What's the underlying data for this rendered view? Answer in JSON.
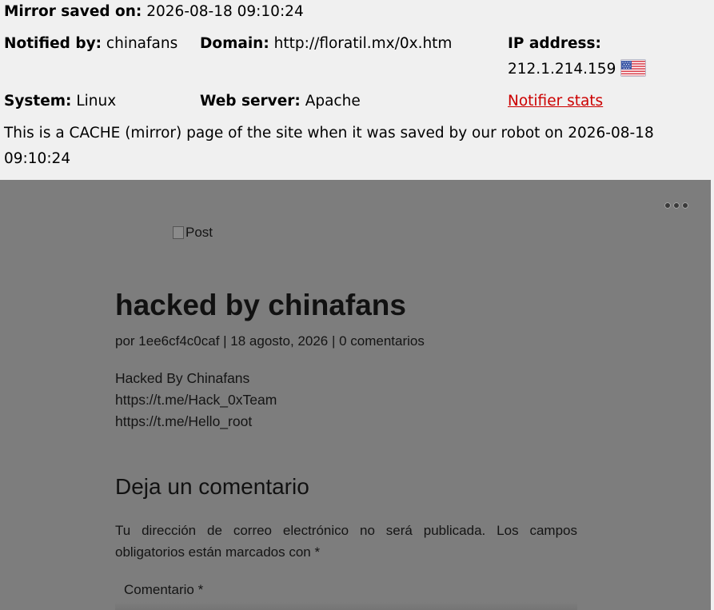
{
  "header": {
    "mirror_saved_label": "Mirror saved on:",
    "mirror_saved_value": "2026-08-18 09:10:24",
    "notified_by_label": "Notified by:",
    "notified_by_value": "chinafans",
    "domain_label": "Domain:",
    "domain_value": "http://floratil.mx/0x.htm",
    "ip_label": "IP address:",
    "ip_value": "212.1.214.159",
    "flag_icon": "us-flag-icon",
    "system_label": "System:",
    "system_value": "Linux",
    "web_server_label": "Web server:",
    "web_server_value": "Apache",
    "notifier_stats_link": "Notifier stats",
    "cache_notice": "This is a CACHE (mirror) page of the site when it was saved by our robot on 2026-08-18 09:10:24"
  },
  "mirror": {
    "menu_icon": "more-dots-icon",
    "post_image_alt": "Post",
    "title": "hacked by chinafans",
    "meta": "por 1ee6cf4c0caf | 18 agosto, 2026 | 0 comentarios",
    "body_lines": [
      "Hacked By Chinafans",
      "https://t.me/Hack_0xTeam",
      "https://t.me/Hello_root"
    ],
    "comment_heading": "Deja un comentario",
    "comment_notice": "Tu dirección de correo electrónico no será publicada. Los campos obligatorios están marcados con *",
    "comment_field_label": "Comentario *"
  },
  "colors": {
    "link": "#cc0000",
    "header_bg": "#f0f0f0",
    "mirror_bg": "#7d7d7d"
  }
}
